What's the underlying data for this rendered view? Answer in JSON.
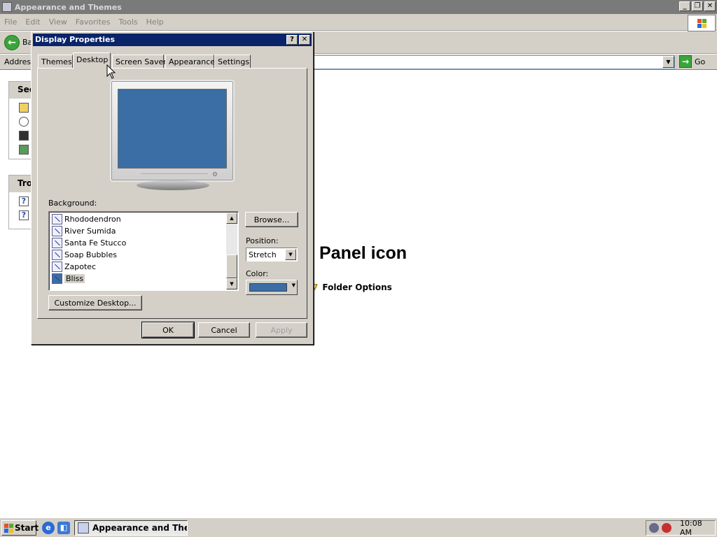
{
  "window": {
    "title": "Appearance and Themes",
    "menu": [
      "File",
      "Edit",
      "View",
      "Favorites",
      "Tools",
      "Help"
    ],
    "toolbar": {
      "back_label": "Ba"
    },
    "address": {
      "label": "Address",
      "go_label": "Go"
    },
    "side_panels": [
      {
        "header": "See"
      },
      {
        "header": "Tro"
      }
    ],
    "content": {
      "heading": "Panel icon",
      "link": "Folder Options"
    }
  },
  "dialog": {
    "title": "Display Properties",
    "help_btn": "?",
    "close_btn": "x",
    "tabs": [
      {
        "label": "Themes"
      },
      {
        "label": "Desktop",
        "active": true
      },
      {
        "label": "Screen Saver"
      },
      {
        "label": "Appearance"
      },
      {
        "label": "Settings"
      }
    ],
    "background_label": "Background:",
    "background_items": [
      {
        "label": "Rhododendron"
      },
      {
        "label": "River Sumida"
      },
      {
        "label": "Santa Fe Stucco"
      },
      {
        "label": "Soap Bubbles"
      },
      {
        "label": "Zapotec"
      },
      {
        "label": "Bliss",
        "selected": true
      }
    ],
    "browse_label": "Browse...",
    "position_label": "Position:",
    "position_value": "Stretch",
    "color_label": "Color:",
    "color_value": "#3a6ea5",
    "customize_label": "Customize Desktop...",
    "ok_label": "OK",
    "cancel_label": "Cancel",
    "apply_label": "Apply"
  },
  "taskbar": {
    "start_label": "Start",
    "task_label": "Appearance and The...",
    "clock": "10:08 AM"
  }
}
